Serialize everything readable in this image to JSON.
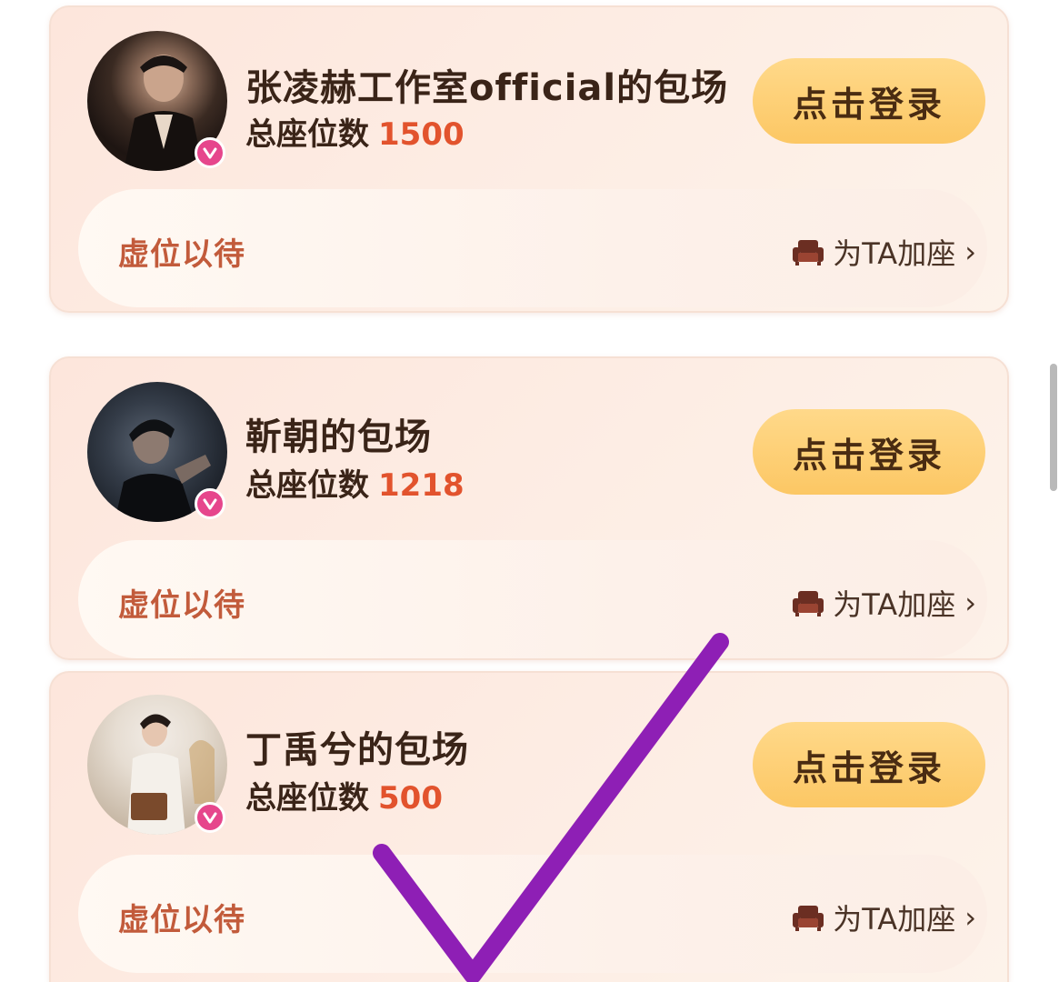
{
  "cards": [
    {
      "title": "张凌赫工作室official的包场",
      "seats_label": "总座位数",
      "seats_value": "1500",
      "login_label": "点击登录",
      "wait_label": "虚位以待",
      "add_seat_label": "为TA加座"
    },
    {
      "title": "靳朝的包场",
      "seats_label": "总座位数",
      "seats_value": "1218",
      "login_label": "点击登录",
      "wait_label": "虚位以待",
      "add_seat_label": "为TA加座"
    },
    {
      "title": "丁禹兮的包场",
      "seats_label": "总座位数",
      "seats_value": "500",
      "login_label": "点击登录",
      "wait_label": "虚位以待",
      "add_seat_label": "为TA加座"
    }
  ],
  "icons": {
    "verified": "verified-badge-icon",
    "seat": "sofa-icon",
    "chevron": "chevron-right-icon",
    "annotation": "purple-check-mark"
  },
  "colors": {
    "accent_number": "#e2532d",
    "button": "#fcc764",
    "badge": "#e6468c",
    "annotation": "#8e1fb5"
  }
}
